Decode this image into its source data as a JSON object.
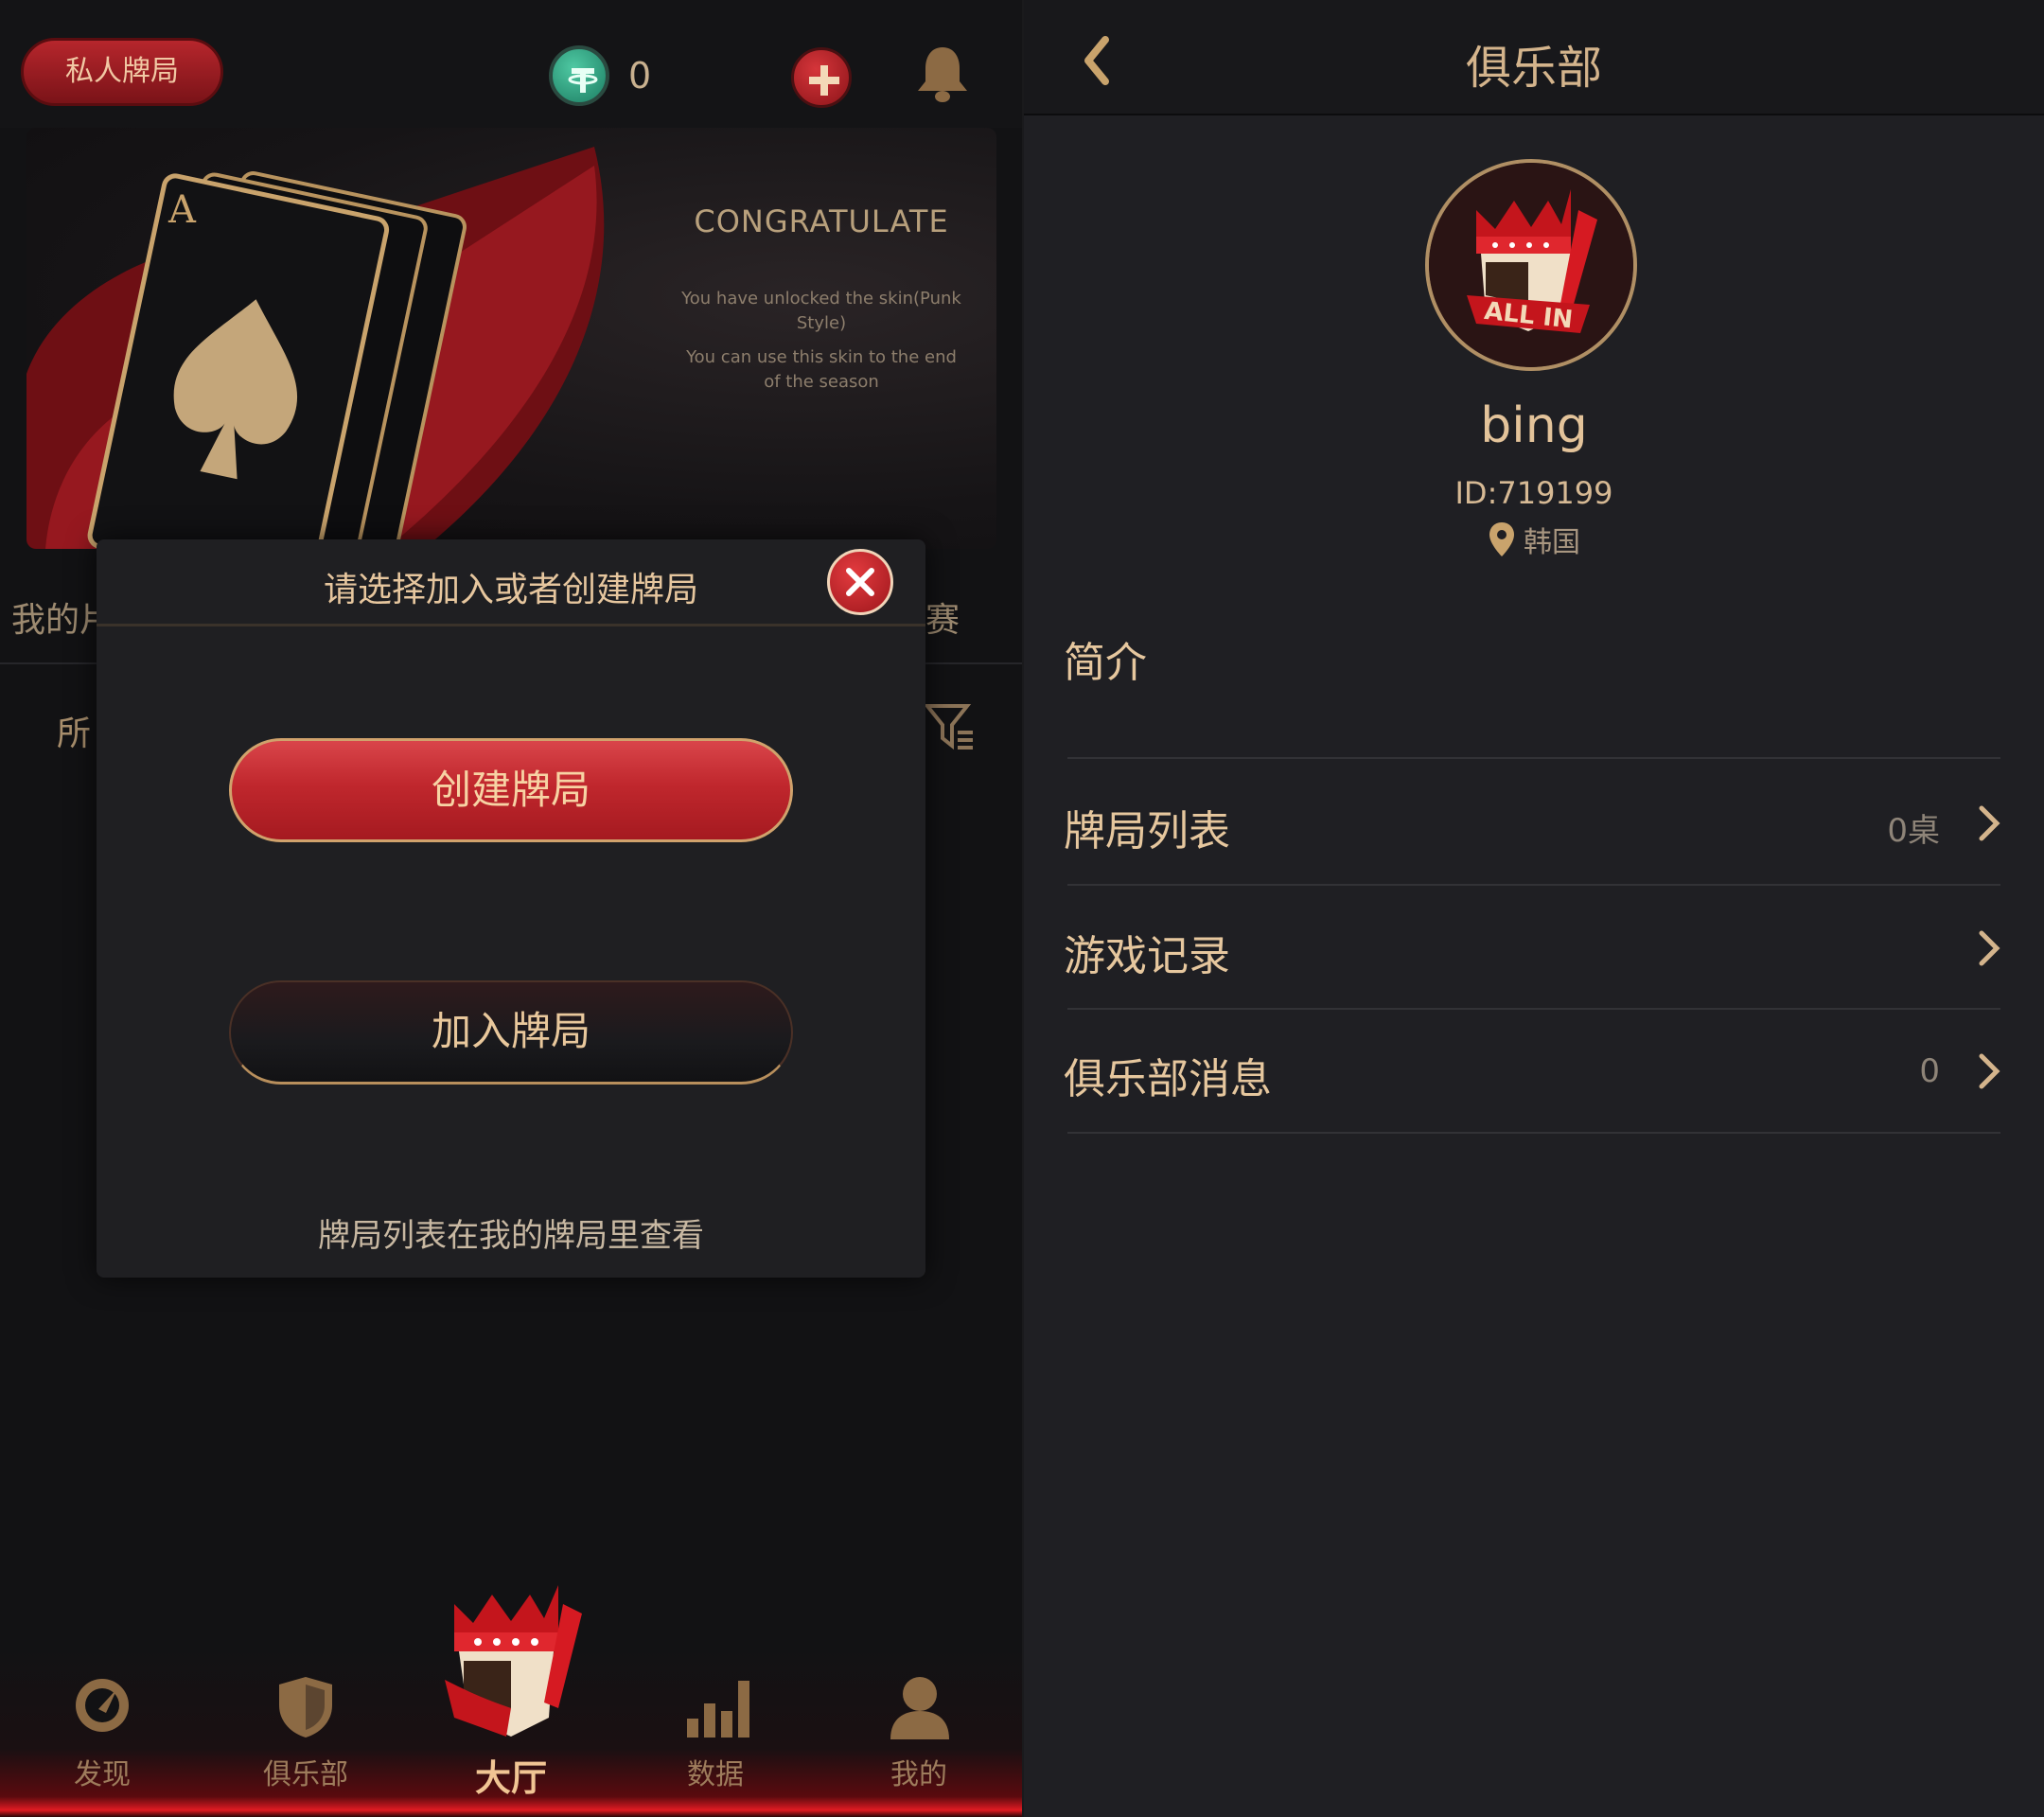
{
  "left": {
    "topbar": {
      "private_table": "私人牌局",
      "coin_balance": "0"
    },
    "banner": {
      "ace_letter": "A",
      "heading": "CONGRATULATE",
      "line1": "You have unlocked the skin(Punk Style)",
      "line2": "You can use this skin to the end of the season"
    },
    "background_tabs": {
      "left_partial": "我的片",
      "right_partial": "赛",
      "filter_partial": "所"
    },
    "modal": {
      "title": "请选择加入或者创建牌局",
      "create_label": "创建牌局",
      "join_label": "加入牌局",
      "hint": "牌局列表在我的牌局里查看"
    },
    "nav": {
      "items": [
        {
          "label": "发现",
          "icon": "compass-icon"
        },
        {
          "label": "俱乐部",
          "icon": "shield-icon"
        },
        {
          "label": "大厅",
          "icon": "king-mascot-icon"
        },
        {
          "label": "数据",
          "icon": "bar-chart-icon"
        },
        {
          "label": "我的",
          "icon": "person-icon"
        }
      ]
    }
  },
  "right": {
    "header": {
      "title": "俱乐部"
    },
    "profile": {
      "name": "bing",
      "id_text": "ID:719199",
      "location": "韩国",
      "avatar_text": "ALL IN"
    },
    "intro_label": "简介",
    "rows": [
      {
        "label": "牌局列表",
        "value": "0桌"
      },
      {
        "label": "游戏记录",
        "value": ""
      },
      {
        "label": "俱乐部消息",
        "value": "0"
      }
    ]
  },
  "colors": {
    "gold": "#e6c79e",
    "red": "#c0272d",
    "bg": "#1f1f23"
  }
}
